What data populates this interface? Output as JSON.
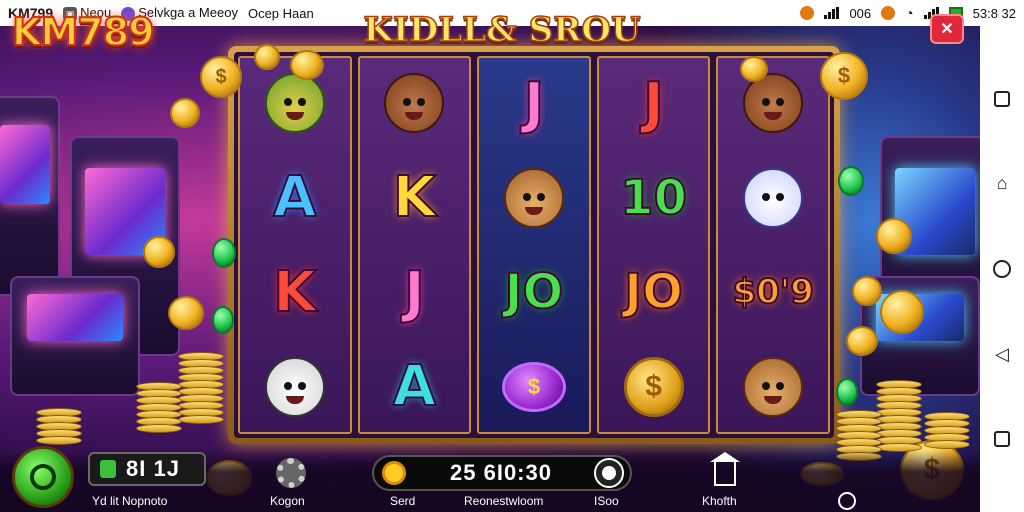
{
  "status_bar": {
    "app_name": "KM799",
    "notif1": "Neou",
    "notif2": "Selvkga a Meeoy",
    "notif3": "Ocep Haan",
    "data_label": "006",
    "time": "53:8 32"
  },
  "game": {
    "logo": "KM789",
    "title": "KIDLL& SROU",
    "close_label": "✕"
  },
  "reels": [
    [
      "bear-green",
      "A",
      "K",
      "panda"
    ],
    [
      "person",
      "K",
      "J",
      "A"
    ],
    [
      "J",
      "bear",
      "JO",
      "coin-purple"
    ],
    [
      "J",
      "10",
      "JO",
      "coin-gold"
    ],
    [
      "person",
      "ghost-card",
      "S0'9",
      "bear"
    ]
  ],
  "symbols": {
    "A_blue": "A",
    "K_yellow": "K",
    "K_red": "K",
    "J_pink": "J",
    "A_cyan": "A",
    "J_pink_2": "J",
    "JO_green": "JO",
    "J_red": "J",
    "ten_green": "10",
    "JO_orange": "JO",
    "s09": "$0'9",
    "coin_glyph": "$",
    "purple_coin_glyph": "$"
  },
  "bottom_bar": {
    "bet_value": "8I 1J",
    "bet_label": "Yd lit Nopnoto",
    "settings_label": "Kogon",
    "balance_value": "25 6I0:30",
    "seid_label": "Serd",
    "balance_label": "Reonestwloom",
    "iso_label": "ISoo",
    "home_label": "Khofth"
  },
  "colors": {
    "accent": "#ffce3a",
    "close": "#e0283a",
    "frame": "#d9a24a"
  }
}
